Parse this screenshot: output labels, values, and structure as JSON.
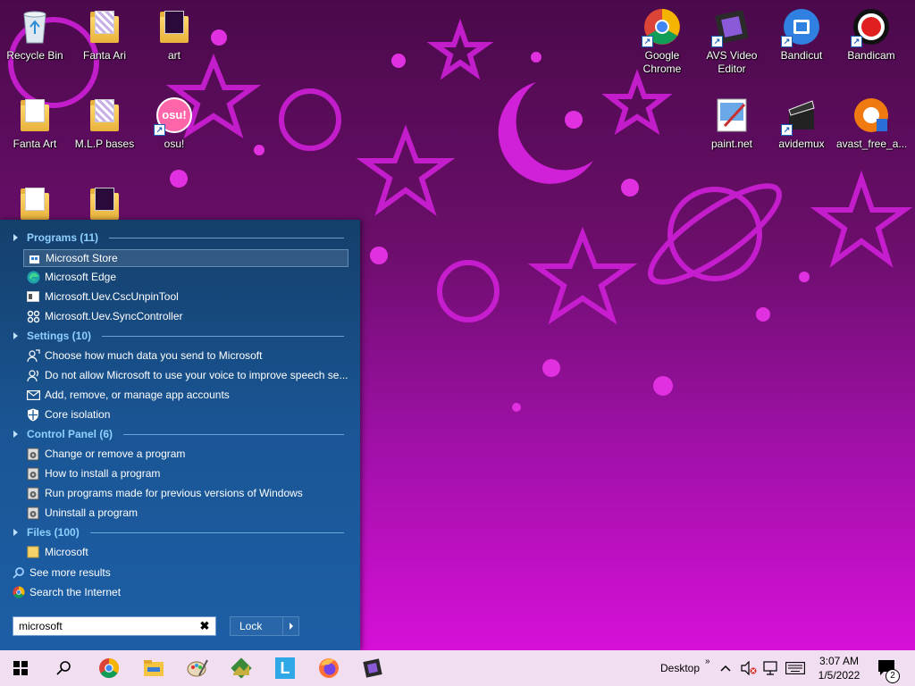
{
  "desktop": {
    "icons": [
      {
        "label": "Recycle Bin",
        "icon": "recycle-bin-icon"
      },
      {
        "label": "Fanta Ari",
        "icon": "folder-icon"
      },
      {
        "label": "art",
        "icon": "folder-icon"
      },
      {
        "label": "Fanta Art",
        "icon": "folder-icon"
      },
      {
        "label": "M.L.P bases",
        "icon": "folder-icon"
      },
      {
        "label": "osu!",
        "icon": "osu-icon"
      },
      {
        "label": "Google Chrome",
        "icon": "chrome-icon"
      },
      {
        "label": "AVS Video Editor",
        "icon": "avs-video-editor-icon"
      },
      {
        "label": "Bandicut",
        "icon": "bandicut-icon"
      },
      {
        "label": "Bandicam",
        "icon": "bandicam-icon"
      },
      {
        "label": "paint.net",
        "icon": "paint-net-icon"
      },
      {
        "label": "avidemux",
        "icon": "avidemux-icon"
      },
      {
        "label": "avast_free_a...",
        "icon": "avast-installer-icon"
      }
    ],
    "osu_text": "osu!"
  },
  "start_menu": {
    "groups": {
      "programs": "Programs (11)",
      "settings": "Settings (10)",
      "control_panel": "Control Panel (6)",
      "files": "Files (100)"
    },
    "programs": [
      "Microsoft Store",
      "Microsoft Edge",
      "Microsoft.Uev.CscUnpinTool",
      "Microsoft.Uev.SyncController"
    ],
    "settings": [
      "Choose how much data you send to Microsoft",
      "Do not allow Microsoft to use your voice to improve speech se...",
      "Add, remove, or manage app accounts",
      "Core isolation"
    ],
    "control_panel": [
      "Change or remove a program",
      "How to install a program",
      "Run programs made for previous versions of Windows",
      "Uninstall a program"
    ],
    "files": [
      "Microsoft"
    ],
    "see_more": "See more results",
    "search_internet": "Search the Internet",
    "search_value": "microsoft",
    "clear_glyph": "✖",
    "lock_label": "Lock"
  },
  "taskbar": {
    "pinned": [
      "windows-start-icon",
      "search-icon",
      "chrome-icon",
      "file-explorer-icon",
      "paint-icon",
      "landscape-app-icon",
      "l-app-icon",
      "firefox-icon",
      "video-editor-icon"
    ],
    "desktop_label": "Desktop",
    "time": "3:07 AM",
    "date": "1/5/2022",
    "notification_count": "2",
    "l_letter": "L"
  },
  "colors": {
    "wallpaper_top": "#4a0a4a",
    "wallpaper_bottom": "#e010e0",
    "star": "#e030e0",
    "start_menu": "#1a5695",
    "group_heading": "#8fd0ff",
    "taskbar": "#f1def1"
  }
}
